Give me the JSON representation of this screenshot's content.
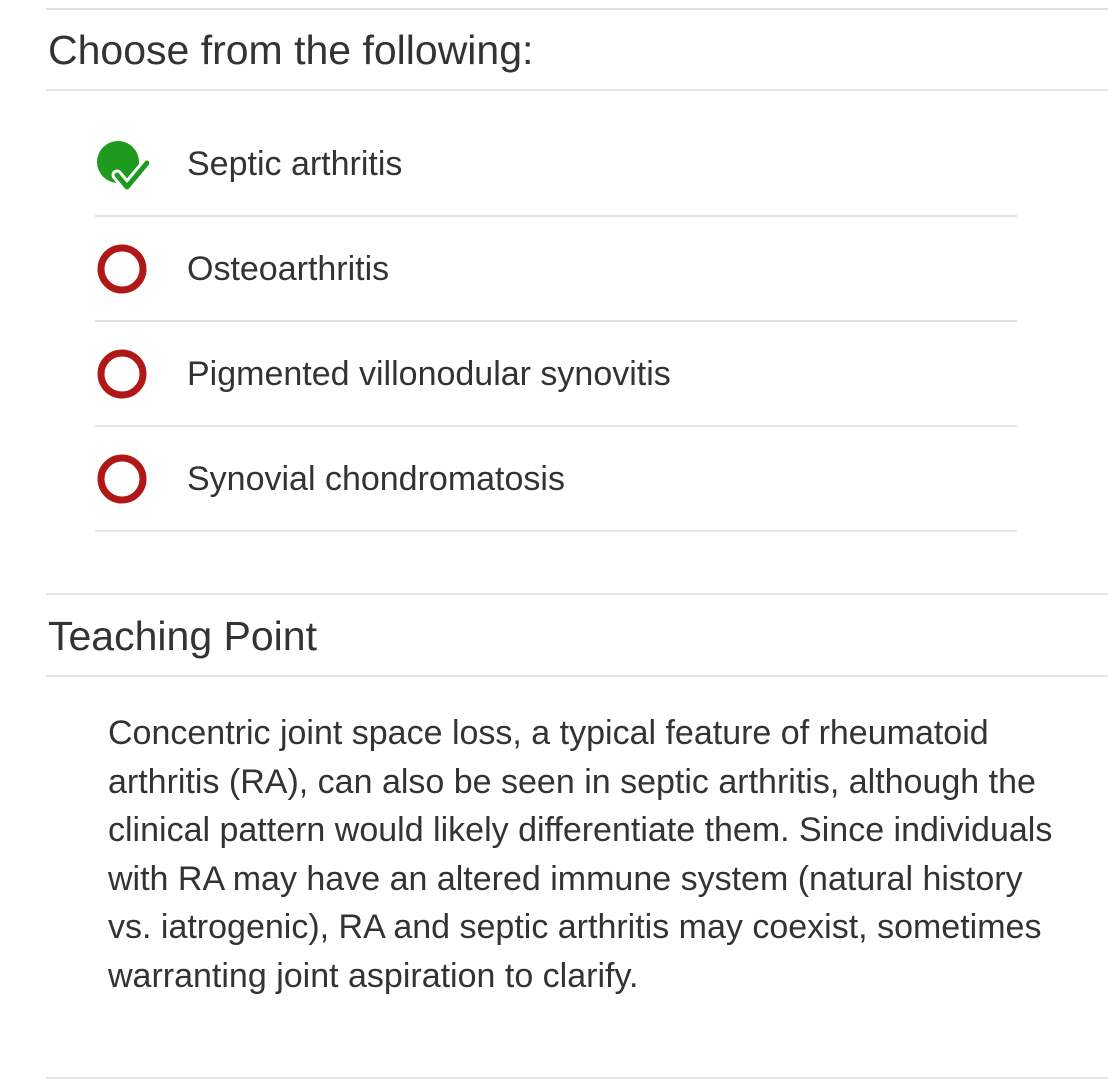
{
  "question": {
    "heading": "Choose from the following:",
    "choices": [
      {
        "label": "Septic arthritis",
        "status": "correct",
        "icon": "green-check-circle-icon"
      },
      {
        "label": "Osteoarthritis",
        "status": "incorrect",
        "icon": "red-ring-icon"
      },
      {
        "label": "Pigmented villonodular synovitis",
        "status": "incorrect",
        "icon": "red-ring-icon"
      },
      {
        "label": "Synovial chondromatosis",
        "status": "incorrect",
        "icon": "red-ring-icon"
      }
    ]
  },
  "teaching_point": {
    "heading": "Teaching Point",
    "body": "Concentric joint space loss, a typical feature of rheumatoid arthritis (RA), can also be seen in septic arthritis, although the clinical pattern would likely differentiate them. Since individuals with RA may have an altered immune system (natural history vs. iatrogenic), RA and septic arthritis may coexist, sometimes warranting joint aspiration to clarify."
  },
  "colors": {
    "correct": "#1e9a1e",
    "incorrect": "#b01818",
    "text": "#333333",
    "divider": "#e3e3e3"
  }
}
